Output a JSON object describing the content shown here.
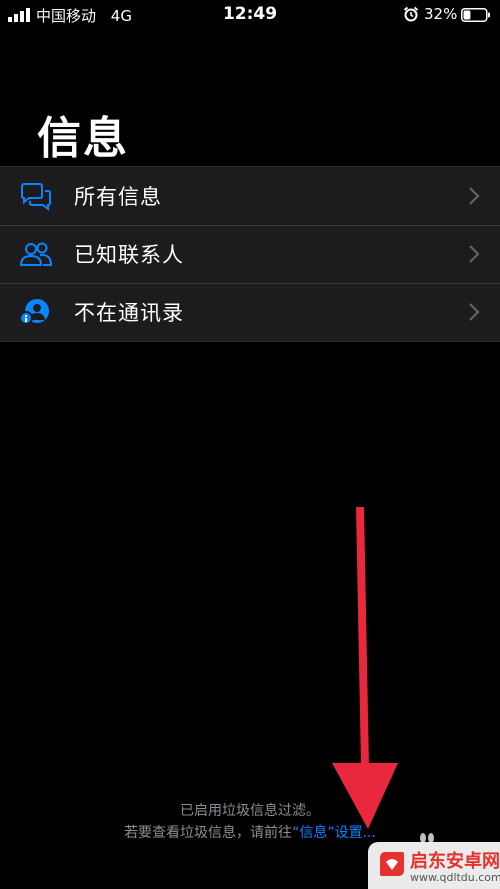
{
  "status_bar": {
    "carrier": "中国移动",
    "network": "4G",
    "time": "12:49",
    "battery": "32%",
    "battery_level": 0.32
  },
  "page": {
    "title": "信息"
  },
  "filters": [
    {
      "label": "所有信息",
      "icon": "speech-bubbles-icon"
    },
    {
      "label": "已知联系人",
      "icon": "people-icon"
    },
    {
      "label": "不在通讯录",
      "icon": "unknown-person-icon"
    }
  ],
  "footer": {
    "line1": "已启用垃圾信息过滤。",
    "line2_prefix": "若要查看垃圾信息，请前往",
    "line2_link": "“信息”",
    "line2_suffix": "设置..."
  },
  "watermark": {
    "name": "启东安卓网",
    "url": "www.qdltdu.com"
  },
  "colors": {
    "background": "#000000",
    "list_bg": "#1c1c1e",
    "accent": "#0a84ff",
    "arrow": "#e8283c",
    "secondary_text": "#8e8e93"
  }
}
